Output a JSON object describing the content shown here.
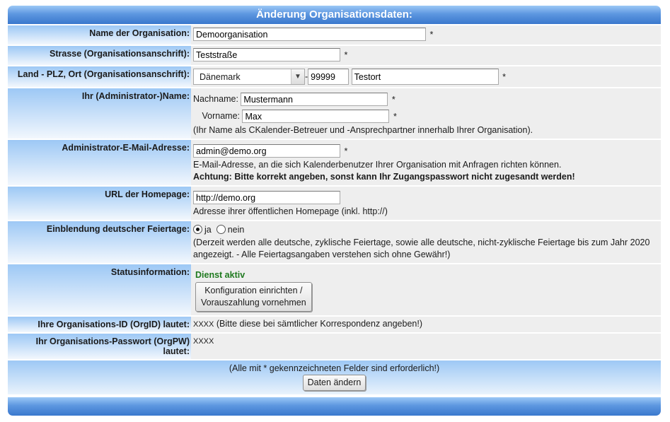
{
  "title": "Änderung Organisationsdaten:",
  "rows": {
    "org_name": {
      "label": "Name der Organisation:",
      "value": "Demoorganisation",
      "req": "*"
    },
    "street": {
      "label": "Strasse (Organisationsanschrift):",
      "value": "Teststraße",
      "req": "*"
    },
    "address": {
      "label": "Land - PLZ, Ort (Organisationsanschrift):",
      "country": "Dänemark",
      "dash": "-",
      "zip": "99999",
      "city": "Testort",
      "req": "*"
    },
    "admin_name": {
      "label": "Ihr (Administrator-)Name:",
      "last_label": "Nachname:",
      "last_value": "Mustermann",
      "first_label": "Vorname:",
      "first_value": "Max",
      "req": "*",
      "note": "(Ihr Name als CKalender-Betreuer und -Ansprechpartner innerhalb Ihrer Organisation)."
    },
    "admin_email": {
      "label": "Administrator-E-Mail-Adresse:",
      "value": "admin@demo.org",
      "req": "*",
      "note": "E-Mail-Adresse, an die sich Kalenderbenutzer Ihrer Organisation mit Anfragen richten können.",
      "warning": "Achtung: Bitte korrekt angeben, sonst kann Ihr Zugangspasswort nicht zugesandt werden!"
    },
    "homepage": {
      "label": "URL der Homepage:",
      "value": "http://demo.org",
      "note": "Adresse ihrer öffentlichen Homepage (inkl. http://)"
    },
    "holidays": {
      "label": "Einblendung deutscher Feiertage:",
      "yes": "ja",
      "no": "nein",
      "selected": "ja",
      "note": "(Derzeit werden alle deutsche, zyklische Feiertage, sowie alle deutsche, nicht-zyklische Feiertage bis zum Jahr 2020 angezeigt. - Alle Feiertagsangaben verstehen sich ohne Gewähr!)"
    },
    "status": {
      "label": "Statusinformation:",
      "value": "Dienst aktiv",
      "button_line1": "Konfiguration einrichten /",
      "button_line2": "Vorauszahlung vornehmen"
    },
    "orgid": {
      "label": "Ihre Organisations-ID (OrgID) lautet:",
      "value": "XXXX",
      "note": "(Bitte diese bei sämtlicher Korrespondenz angeben!)"
    },
    "orgpw": {
      "label": "Ihr Organisations-Passwort (OrgPW) lautet:",
      "value": "XXXX"
    }
  },
  "footer": {
    "note": "(Alle mit * gekennzeichneten Felder sind erforderlich!)",
    "submit": "Daten ändern"
  },
  "colors": {
    "header_blue": "#3a78cd",
    "label_blue": "#9dc8f5",
    "value_bg": "#eeeeee",
    "status_green": "#1f7a1f"
  }
}
